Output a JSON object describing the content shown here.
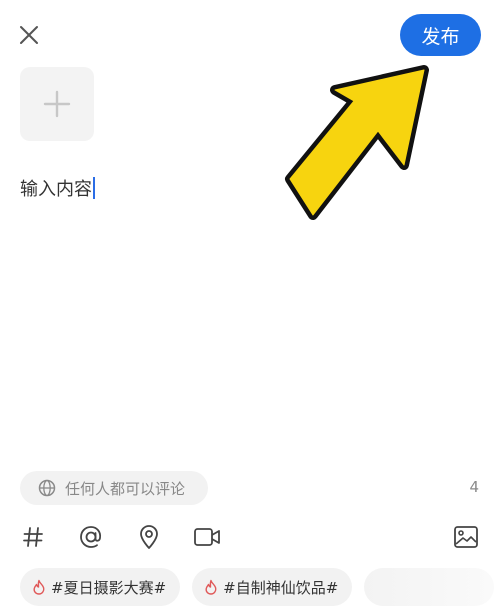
{
  "header": {
    "close_icon": "close-icon",
    "publish_label": "发布",
    "publish_color": "#1e6fe4"
  },
  "composer": {
    "add_media_icon": "plus-icon",
    "content_placeholder": "输入内容"
  },
  "annotation": {
    "arrow_icon": "pointer-arrow-icon",
    "arrow_color": "#f7d40f"
  },
  "footer": {
    "comment_permission_icon": "globe-icon",
    "comment_permission_label": "任何人都可以评论",
    "char_count": "4",
    "toolbar": [
      {
        "name": "hashtag-icon"
      },
      {
        "name": "mention-icon"
      },
      {
        "name": "location-icon"
      },
      {
        "name": "video-icon"
      },
      {
        "name": "image-icon"
      }
    ],
    "tags": [
      {
        "icon": "flame-icon",
        "label": "#夏日摄影大赛#"
      },
      {
        "icon": "flame-icon",
        "label": "#自制神仙饮品#"
      }
    ]
  }
}
